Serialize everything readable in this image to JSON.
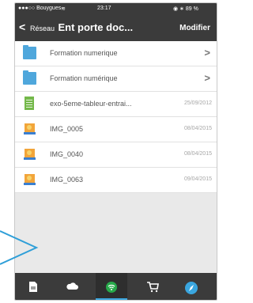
{
  "status": {
    "carrier": "●●●○○ Bouygues",
    "wifi": "≋",
    "time": "23:17",
    "right": "◉ ∗ 89 %"
  },
  "nav": {
    "back": "<",
    "title_prefix": "Réseau",
    "title_main": "Ent porte doc...",
    "action": "Modifier"
  },
  "items": [
    {
      "name": "Formation numerique",
      "date": "",
      "kind": "folder",
      "chevron": ">"
    },
    {
      "name": "Formation numérique",
      "date": "",
      "kind": "folder",
      "chevron": ">"
    },
    {
      "name": "exo-5eme-tableur-entrai...",
      "date": "25/09/2012",
      "kind": "spreadsheet",
      "chevron": ""
    },
    {
      "name": "IMG_0005",
      "date": "08/04/2015",
      "kind": "image",
      "chevron": ""
    },
    {
      "name": "IMG_0040",
      "date": "08/04/2015",
      "kind": "image",
      "chevron": ""
    },
    {
      "name": "IMG_0063",
      "date": "09/04/2015",
      "kind": "image",
      "chevron": ""
    }
  ],
  "tabbar": {
    "tabs": [
      {
        "icon": "document-icon"
      },
      {
        "icon": "cloud-icon"
      },
      {
        "icon": "network-icon",
        "active": true
      },
      {
        "icon": "cart-icon"
      },
      {
        "icon": "compass-icon"
      }
    ],
    "accent": "#3aa6df"
  }
}
